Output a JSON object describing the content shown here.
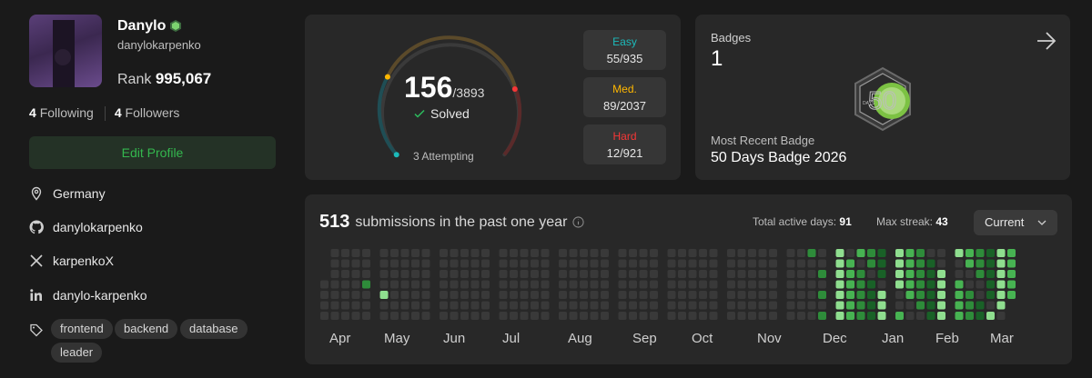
{
  "profile": {
    "display_name": "Danylo",
    "username": "danylokarpenko",
    "rank_label": "Rank",
    "rank_value": "995,067",
    "following_count": "4",
    "following_label": "Following",
    "followers_count": "4",
    "followers_label": "Followers",
    "edit_button": "Edit Profile",
    "location": "Germany",
    "github": "danylokarpenko",
    "x_handle": "karpenkoX",
    "linkedin": "danylo-karpenko",
    "tags": [
      "frontend",
      "backend",
      "database",
      "leader"
    ]
  },
  "progress": {
    "solved": "156",
    "total": "/3893",
    "solved_label": "Solved",
    "attempting": "3 Attempting",
    "solved_fraction": 0.04,
    "difficulties": [
      {
        "label": "Easy",
        "count": "55/935",
        "color": "#1cbaba"
      },
      {
        "label": "Med.",
        "count": "89/2037",
        "color": "#ffb700"
      },
      {
        "label": "Hard",
        "count": "12/921",
        "color": "#f63737"
      }
    ]
  },
  "badges": {
    "label": "Badges",
    "count": "1",
    "recent_label": "Most Recent Badge",
    "recent_name": "50 Days Badge 2026",
    "badge_number": "50",
    "badge_text": "DAYS"
  },
  "submissions": {
    "count": "513",
    "label": "submissions in the past one year",
    "active_days_label": "Total active days:",
    "active_days": "91",
    "max_streak_label": "Max streak:",
    "max_streak": "43",
    "dropdown_value": "Current",
    "months": [
      "Apr",
      "May",
      "Jun",
      "Jul",
      "Aug",
      "Sep",
      "Oct",
      "Nov",
      "Dec",
      "Jan",
      "Feb",
      "Mar"
    ]
  },
  "colors": {
    "accent_green": "#2cbb5d",
    "card_bg": "#282828",
    "page_bg": "#1a1a1a",
    "heat_empty": "#393939",
    "heat_levels": [
      "#196127",
      "#2e8c3a",
      "#47b352",
      "#8fde8f"
    ]
  }
}
